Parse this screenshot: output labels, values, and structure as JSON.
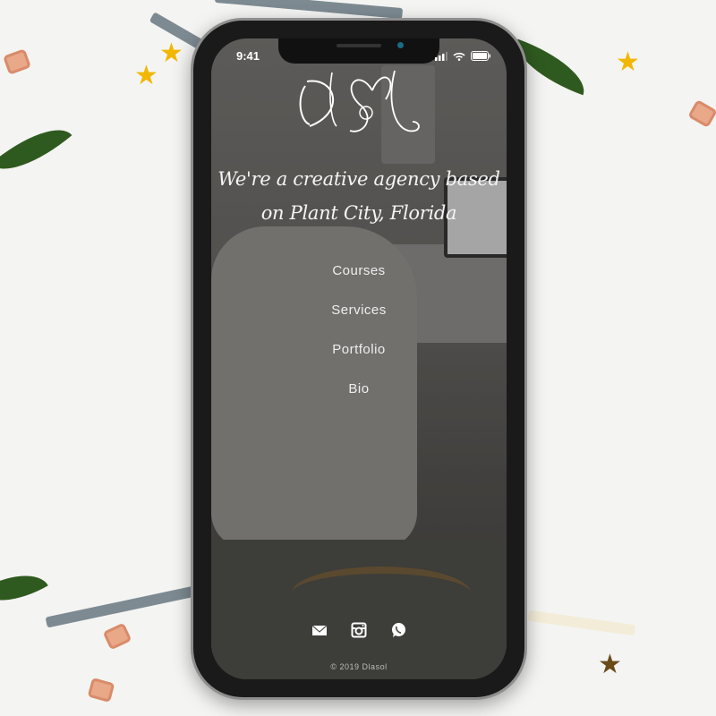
{
  "status_bar": {
    "time": "9:41"
  },
  "site": {
    "logo_text": "DlaSol",
    "tagline_line1": "We're a creative agency based",
    "tagline_line2": "on Plant City, Florida",
    "nav": [
      {
        "label": "Courses"
      },
      {
        "label": "Services"
      },
      {
        "label": "Portfolio"
      },
      {
        "label": "Bio"
      }
    ],
    "social": [
      "mail-icon",
      "instagram-icon",
      "whatsapp-icon"
    ],
    "footer": "© 2019 Dlasol"
  },
  "colors": {
    "background": "#f4f4f2",
    "star": "#f2b705",
    "leaf": "#2f5a1f"
  }
}
